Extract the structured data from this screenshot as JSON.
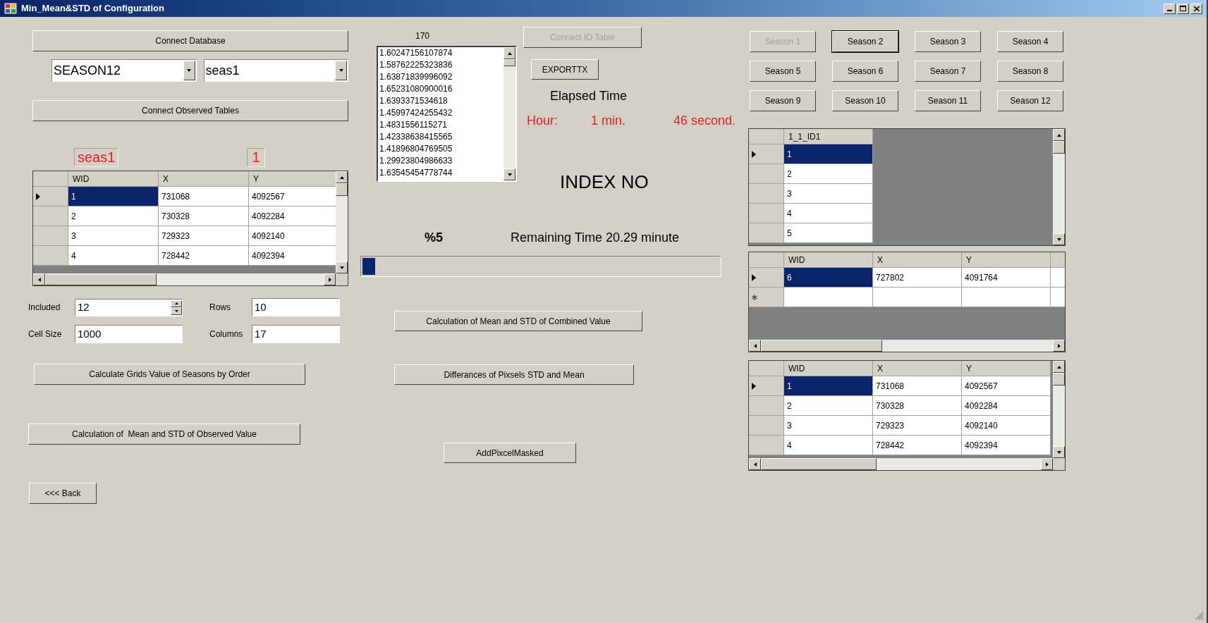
{
  "window": {
    "title": "Min_Mean&STD of Configuration"
  },
  "connect_database": "Connect Database",
  "database_combo": {
    "value": "SEASON12"
  },
  "table_combo": {
    "value": "seas1"
  },
  "connect_observed": "Connect Observed Tables",
  "table_name_label": "seas1",
  "table_index_label": "1",
  "observed_grid": {
    "columns": [
      "WID",
      "X",
      "Y"
    ],
    "rows": [
      {
        "kind": "data",
        "cells": [
          "1",
          "731068",
          "4092567"
        ],
        "selected": true
      },
      {
        "kind": "data",
        "cells": [
          "2",
          "730328",
          "4092284"
        ],
        "selected": false
      },
      {
        "kind": "data",
        "cells": [
          "3",
          "729323",
          "4092140"
        ],
        "selected": false
      },
      {
        "kind": "data",
        "cells": [
          "4",
          "728442",
          "4092394"
        ],
        "selected": false
      }
    ]
  },
  "parameters": [
    {
      "label": "Included",
      "value": "12",
      "kind": "spinner"
    },
    {
      "label": "Rows",
      "value": "10",
      "kind": "text"
    },
    {
      "label": "Cell Size",
      "value": "1000",
      "kind": "text"
    },
    {
      "label": "Columns",
      "value": "17",
      "kind": "text"
    }
  ],
  "calculate_grids": "Calculate Grids Value of Seasons by Order",
  "calculate_observed": "Calculation of  Mean and STD of Observed Value",
  "back": "<<< Back",
  "value_list": {
    "count": "170",
    "items": [
      "1.60247156107874",
      "1.58762225323836",
      "1.63871839996092",
      "1.65231080900016",
      "1.6393371534618",
      "1.45997424255432",
      "1.4831556115271",
      "1.42338638415565",
      "1.41896804769505",
      "1.29923804986633",
      "1.63545454778744"
    ]
  },
  "connect_id_table": {
    "label": "Connect ID Table",
    "disabled": true
  },
  "export": "EXPORTTX",
  "elapsed": {
    "title": "Elapsed Time",
    "hour": "Hour:",
    "minutes": "1 min.",
    "seconds": "46 second."
  },
  "index_label": "INDEX NO",
  "progress": {
    "percent": "%5",
    "remaining": "Remaining Time 20.29 minute",
    "level": 0.035
  },
  "calc_combined": "Calculation of Mean and STD of Combined Value",
  "differences": "Differances of Pixsels STD and Mean",
  "add_masked": "AddPixcelMasked",
  "seasons": [
    {
      "label": "Season 1",
      "disabled": true,
      "focused": false
    },
    {
      "label": "Season 2",
      "disabled": false,
      "focused": true
    },
    {
      "label": "Season 3",
      "disabled": false,
      "focused": false
    },
    {
      "label": "Season 4",
      "disabled": false,
      "focused": false
    },
    {
      "label": "Season 5",
      "disabled": false,
      "focused": false
    },
    {
      "label": "Season 6",
      "disabled": false,
      "focused": false
    },
    {
      "label": "Season 7",
      "disabled": false,
      "focused": false
    },
    {
      "label": "Season 8",
      "disabled": false,
      "focused": false
    },
    {
      "label": "Season 9",
      "disabled": false,
      "focused": false
    },
    {
      "label": "Season 10",
      "disabled": false,
      "focused": false
    },
    {
      "label": "Season 11",
      "disabled": false,
      "focused": false
    },
    {
      "label": "Season 12",
      "disabled": false,
      "focused": false
    }
  ],
  "id_grid": {
    "columns": [
      "1_1_ID1"
    ],
    "rows": [
      {
        "kind": "data",
        "cells": [
          "1"
        ],
        "selected": true
      },
      {
        "kind": "data",
        "cells": [
          "2"
        ],
        "selected": false
      },
      {
        "kind": "data",
        "cells": [
          "3"
        ],
        "selected": false
      },
      {
        "kind": "data",
        "cells": [
          "4"
        ],
        "selected": false
      },
      {
        "kind": "data",
        "cells": [
          "5"
        ],
        "selected": false
      }
    ]
  },
  "selected_grid": {
    "columns": [
      "WID",
      "X",
      "Y"
    ],
    "rows": [
      {
        "kind": "data",
        "cells": [
          "6",
          "727802",
          "4091764"
        ],
        "selected": true
      },
      {
        "kind": "new",
        "selected": false
      }
    ]
  },
  "result_grid": {
    "columns": [
      "WID",
      "X",
      "Y"
    ],
    "rows": [
      {
        "kind": "data",
        "cells": [
          "1",
          "731068",
          "4092567"
        ],
        "selected": true
      },
      {
        "kind": "data",
        "cells": [
          "2",
          "730328",
          "4092284"
        ],
        "selected": false
      },
      {
        "kind": "data",
        "cells": [
          "3",
          "729323",
          "4092140"
        ],
        "selected": false
      },
      {
        "kind": "data",
        "cells": [
          "4",
          "728442",
          "4092394"
        ],
        "selected": false
      }
    ]
  }
}
